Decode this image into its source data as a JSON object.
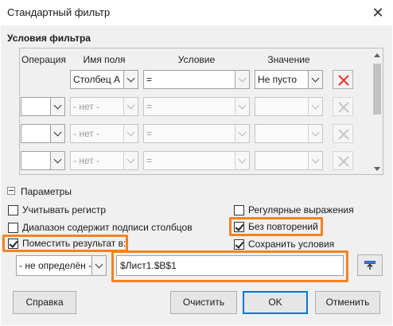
{
  "window": {
    "title": "Стандартный фильтр",
    "close_glyph": "✕"
  },
  "filter": {
    "section_title": "Условия фильтра",
    "headers": {
      "operation": "Операция",
      "field": "Имя поля",
      "condition": "Условие",
      "value": "Значение"
    },
    "rows": [
      {
        "operation": "",
        "field": "Столбец A",
        "condition": "=",
        "value": "Не пусто",
        "enabled": true
      },
      {
        "operation": "",
        "field": "- нет -",
        "condition": "=",
        "value": "",
        "enabled": false
      },
      {
        "operation": "",
        "field": "- нет -",
        "condition": "=",
        "value": "",
        "enabled": false
      },
      {
        "operation": "",
        "field": "- нет -",
        "condition": "=",
        "value": "",
        "enabled": false
      }
    ]
  },
  "options": {
    "expander_label": "Параметры",
    "case_sensitive": {
      "label": "Учитывать регистр",
      "checked": false
    },
    "range_has_headers": {
      "label": "Диапазон содержит подписи столбцов",
      "checked": false
    },
    "copy_results": {
      "label": "Поместить результат в:",
      "checked": true
    },
    "regex": {
      "label": "Регулярные выражения",
      "checked": false
    },
    "no_duplicates": {
      "label": "Без повторений",
      "checked": true
    },
    "keep_criteria": {
      "label": "Сохранить условия",
      "checked": true
    },
    "target_select": "- не определён -",
    "target_ref": "$Лист1.$B$1"
  },
  "buttons": {
    "help": "Справка",
    "reset": "Очистить",
    "ok": "OK",
    "cancel": "Отменить"
  },
  "colors": {
    "highlight": "#f5821f",
    "delete_red": "#e53935",
    "default_button_border": "#0078d7"
  }
}
